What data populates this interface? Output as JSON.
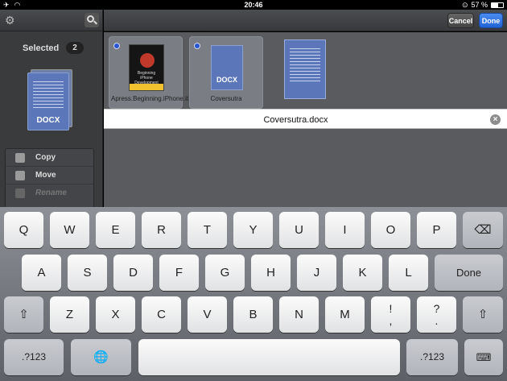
{
  "status_bar": {
    "time": "20:46",
    "battery_text": "57 %",
    "battery_level": 0.57
  },
  "sidebar": {
    "selected_label": "Selected",
    "selected_count": "2",
    "stack_doc_label": "DOCX",
    "actions": [
      {
        "label": "Copy",
        "enabled": true
      },
      {
        "label": "Move",
        "enabled": true
      },
      {
        "label": "Rename",
        "enabled": false
      }
    ]
  },
  "toolbar": {
    "cancel_label": "Cancel",
    "done_label": "Done"
  },
  "files": [
    {
      "caption": "Apress.Beginning.iPhone.it.Devel...SDK.Jan",
      "book_title": "Beginning iPhone Development"
    },
    {
      "caption": "Coversutra",
      "doc_label": "DOCX"
    }
  ],
  "rename": {
    "value": "Coversutra.docx"
  },
  "keyboard": {
    "row1": [
      "Q",
      "W",
      "E",
      "R",
      "T",
      "Y",
      "U",
      "I",
      "O",
      "P"
    ],
    "row2": [
      "A",
      "S",
      "D",
      "F",
      "G",
      "H",
      "J",
      "K",
      "L"
    ],
    "row2_return": "Done",
    "row3": [
      "Z",
      "X",
      "C",
      "V",
      "B",
      "N",
      "M"
    ],
    "row3_punct": [
      {
        "top": "!",
        "bottom": ","
      },
      {
        "top": "?",
        "bottom": "."
      }
    ],
    "numbers_label": ".?123"
  }
}
